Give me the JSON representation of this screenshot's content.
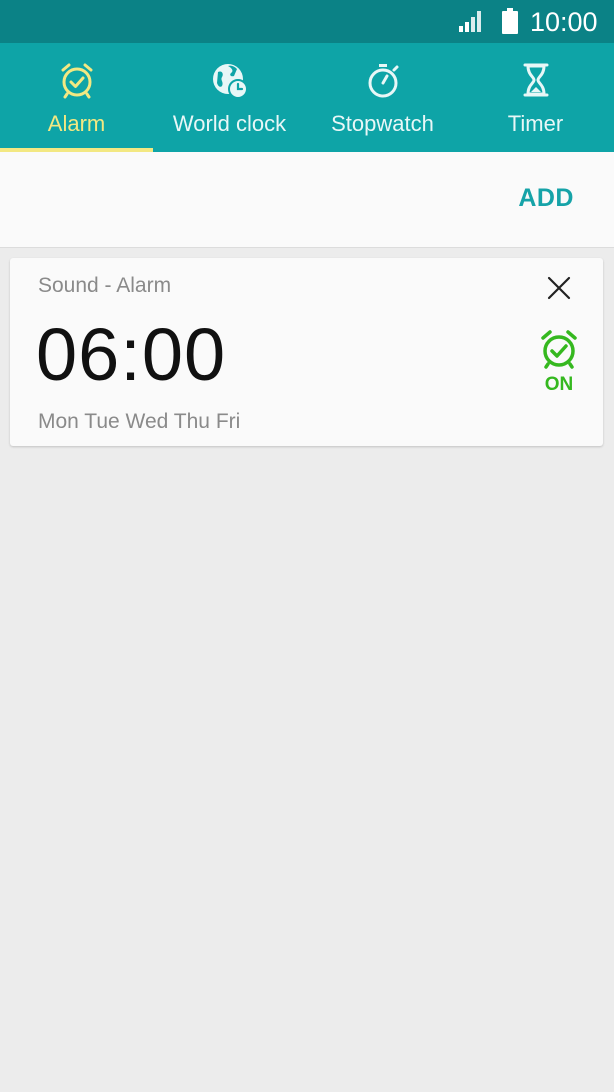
{
  "status_bar": {
    "time": "10:00",
    "icons": [
      "signal-icon",
      "battery-icon"
    ]
  },
  "tabs": [
    {
      "label": "Alarm",
      "icon": "alarm-clock-icon",
      "active": true
    },
    {
      "label": "World clock",
      "icon": "world-clock-icon",
      "active": false
    },
    {
      "label": "Stopwatch",
      "icon": "stopwatch-icon",
      "active": false
    },
    {
      "label": "Timer",
      "icon": "hourglass-icon",
      "active": false
    }
  ],
  "action_bar": {
    "add_label": "ADD"
  },
  "alarms": [
    {
      "name": "Sound - Alarm",
      "time": "06:00",
      "days": "Mon Tue Wed Thu Fri",
      "toggle_label": "ON",
      "enabled": true
    }
  ],
  "colors": {
    "status_bar": "#0b8286",
    "tab_bar": "#0ea4a7",
    "active_tab": "#f3e882",
    "accent": "#16a3a8",
    "alarm_on": "#35b81f",
    "background": "#ececec"
  }
}
